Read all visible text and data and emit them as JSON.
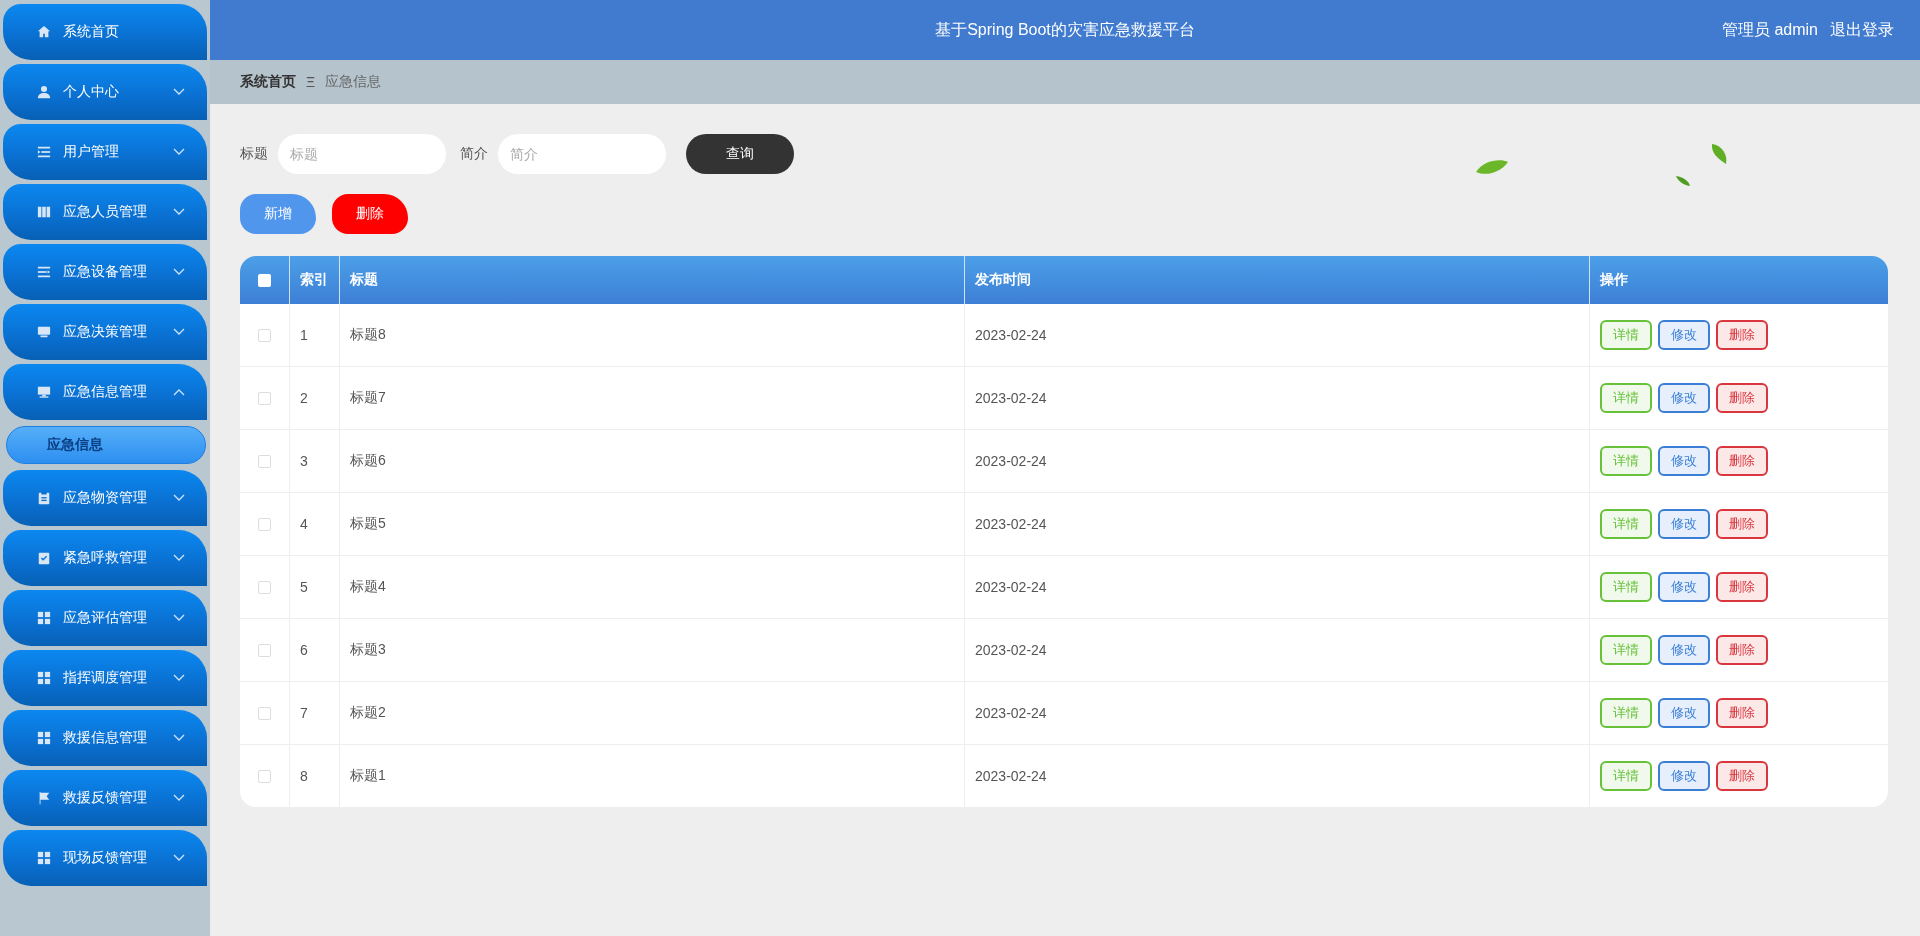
{
  "header": {
    "title": "基于Spring Boot的灾害应急救援平台",
    "user": "管理员 admin",
    "logout": "退出登录"
  },
  "sidebar": {
    "items": [
      {
        "label": "系统首页"
      },
      {
        "label": "个人中心",
        "expanded": false
      },
      {
        "label": "用户管理",
        "expanded": false
      },
      {
        "label": "应急人员管理",
        "expanded": false
      },
      {
        "label": "应急设备管理",
        "expanded": false
      },
      {
        "label": "应急决策管理",
        "expanded": false
      },
      {
        "label": "应急信息管理",
        "expanded": true,
        "children": [
          {
            "label": "应急信息",
            "selected": true
          }
        ]
      },
      {
        "label": "应急物资管理",
        "expanded": false
      },
      {
        "label": "紧急呼救管理",
        "expanded": false
      },
      {
        "label": "应急评估管理",
        "expanded": false
      },
      {
        "label": "指挥调度管理",
        "expanded": false
      },
      {
        "label": "救援信息管理",
        "expanded": false
      },
      {
        "label": "救援反馈管理",
        "expanded": false
      },
      {
        "label": "现场反馈管理",
        "expanded": false
      }
    ]
  },
  "breadcrumb": {
    "items": [
      "系统首页",
      "应急信息"
    ],
    "separator": "Ξ"
  },
  "search": {
    "fields": [
      {
        "label": "标题",
        "placeholder": "标题"
      },
      {
        "label": "简介",
        "placeholder": "简介"
      }
    ],
    "button": "查询"
  },
  "actions": [
    {
      "kind": "add",
      "label": "新增"
    },
    {
      "kind": "delete",
      "label": "删除"
    }
  ],
  "table": {
    "select_all_checked": false,
    "columns": [
      "索引",
      "标题",
      "发布时间",
      "操作"
    ],
    "rows": [
      {
        "checked": false,
        "index": "1",
        "title": "标题8",
        "date": "2023-02-24",
        "actions": [
          {
            "kind": "detail",
            "label": "详情"
          },
          {
            "kind": "edit",
            "label": "修改"
          },
          {
            "kind": "delete",
            "label": "删除"
          }
        ]
      },
      {
        "checked": false,
        "index": "2",
        "title": "标题7",
        "date": "2023-02-24",
        "actions": [
          {
            "kind": "detail",
            "label": "详情"
          },
          {
            "kind": "edit",
            "label": "修改"
          },
          {
            "kind": "delete",
            "label": "删除"
          }
        ]
      },
      {
        "checked": false,
        "index": "3",
        "title": "标题6",
        "date": "2023-02-24",
        "actions": [
          {
            "kind": "detail",
            "label": "详情"
          },
          {
            "kind": "edit",
            "label": "修改"
          },
          {
            "kind": "delete",
            "label": "删除"
          }
        ]
      },
      {
        "checked": false,
        "index": "4",
        "title": "标题5",
        "date": "2023-02-24",
        "actions": [
          {
            "kind": "detail",
            "label": "详情"
          },
          {
            "kind": "edit",
            "label": "修改"
          },
          {
            "kind": "delete",
            "label": "删除"
          }
        ]
      },
      {
        "checked": false,
        "index": "5",
        "title": "标题4",
        "date": "2023-02-24",
        "actions": [
          {
            "kind": "detail",
            "label": "详情"
          },
          {
            "kind": "edit",
            "label": "修改"
          },
          {
            "kind": "delete",
            "label": "删除"
          }
        ]
      },
      {
        "checked": false,
        "index": "6",
        "title": "标题3",
        "date": "2023-02-24",
        "actions": [
          {
            "kind": "detail",
            "label": "详情"
          },
          {
            "kind": "edit",
            "label": "修改"
          },
          {
            "kind": "delete",
            "label": "删除"
          }
        ]
      },
      {
        "checked": false,
        "index": "7",
        "title": "标题2",
        "date": "2023-02-24",
        "actions": [
          {
            "kind": "detail",
            "label": "详情"
          },
          {
            "kind": "edit",
            "label": "修改"
          },
          {
            "kind": "delete",
            "label": "删除"
          }
        ]
      },
      {
        "checked": false,
        "index": "8",
        "title": "标题1",
        "date": "2023-02-24",
        "actions": [
          {
            "kind": "detail",
            "label": "详情"
          },
          {
            "kind": "edit",
            "label": "修改"
          },
          {
            "kind": "delete",
            "label": "删除"
          }
        ]
      }
    ]
  }
}
